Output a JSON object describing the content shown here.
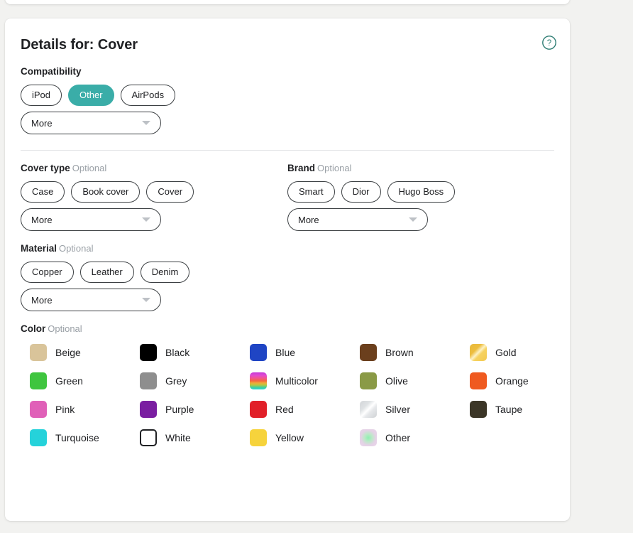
{
  "header": {
    "title": "Details for: Cover",
    "help_icon": "help-circle-icon"
  },
  "sections": {
    "compatibility": {
      "label": "Compatibility",
      "optional": "",
      "pills": [
        {
          "label": "iPod",
          "selected": false
        },
        {
          "label": "Other",
          "selected": true
        },
        {
          "label": "AirPods",
          "selected": false
        }
      ],
      "more_label": "More"
    },
    "cover_type": {
      "label": "Cover type",
      "optional": "Optional",
      "pills": [
        {
          "label": "Case",
          "selected": false
        },
        {
          "label": "Book cover",
          "selected": false
        },
        {
          "label": "Cover",
          "selected": false
        }
      ],
      "more_label": "More"
    },
    "brand": {
      "label": "Brand",
      "optional": "Optional",
      "pills": [
        {
          "label": "Smart",
          "selected": false
        },
        {
          "label": "Dior",
          "selected": false
        },
        {
          "label": "Hugo Boss",
          "selected": false
        }
      ],
      "more_label": "More"
    },
    "material": {
      "label": "Material",
      "optional": "Optional",
      "pills": [
        {
          "label": "Copper",
          "selected": false
        },
        {
          "label": "Leather",
          "selected": false
        },
        {
          "label": "Denim",
          "selected": false
        }
      ],
      "more_label": "More"
    },
    "color": {
      "label": "Color",
      "optional": "Optional",
      "swatches": [
        {
          "name": "Beige",
          "hex": "#d9c49a",
          "style": "solid"
        },
        {
          "name": "Black",
          "hex": "#000000",
          "style": "solid"
        },
        {
          "name": "Blue",
          "hex": "#1f45c4",
          "style": "solid"
        },
        {
          "name": "Brown",
          "hex": "#6b3f1d",
          "style": "solid"
        },
        {
          "name": "Gold",
          "hex": "#f0c04a",
          "style": "diagonal-gold"
        },
        {
          "name": "Green",
          "hex": "#3fc53f",
          "style": "solid"
        },
        {
          "name": "Grey",
          "hex": "#8e8e8e",
          "style": "solid"
        },
        {
          "name": "Multicolor",
          "hex": "#c840d8",
          "style": "rainbow"
        },
        {
          "name": "Olive",
          "hex": "#8a9a46",
          "style": "solid"
        },
        {
          "name": "Orange",
          "hex": "#ef5a20",
          "style": "solid"
        },
        {
          "name": "Pink",
          "hex": "#e060b8",
          "style": "solid"
        },
        {
          "name": "Purple",
          "hex": "#7a1ea1",
          "style": "solid"
        },
        {
          "name": "Red",
          "hex": "#e12029",
          "style": "solid"
        },
        {
          "name": "Silver",
          "hex": "#d7d9db",
          "style": "diagonal-silver"
        },
        {
          "name": "Taupe",
          "hex": "#3b3627",
          "style": "solid"
        },
        {
          "name": "Turquoise",
          "hex": "#25d2da",
          "style": "solid"
        },
        {
          "name": "White",
          "hex": "#ffffff",
          "style": "outlined"
        },
        {
          "name": "Yellow",
          "hex": "#f6d33c",
          "style": "solid"
        },
        {
          "name": "Other",
          "hex": "#e8d3e8",
          "style": "radial-other"
        }
      ]
    }
  },
  "colors": {
    "accent_teal": "#3aada8",
    "card_bg": "#ffffff",
    "page_bg": "#f2f2f0",
    "text_primary": "#202124",
    "text_muted": "#9aa0a6"
  }
}
